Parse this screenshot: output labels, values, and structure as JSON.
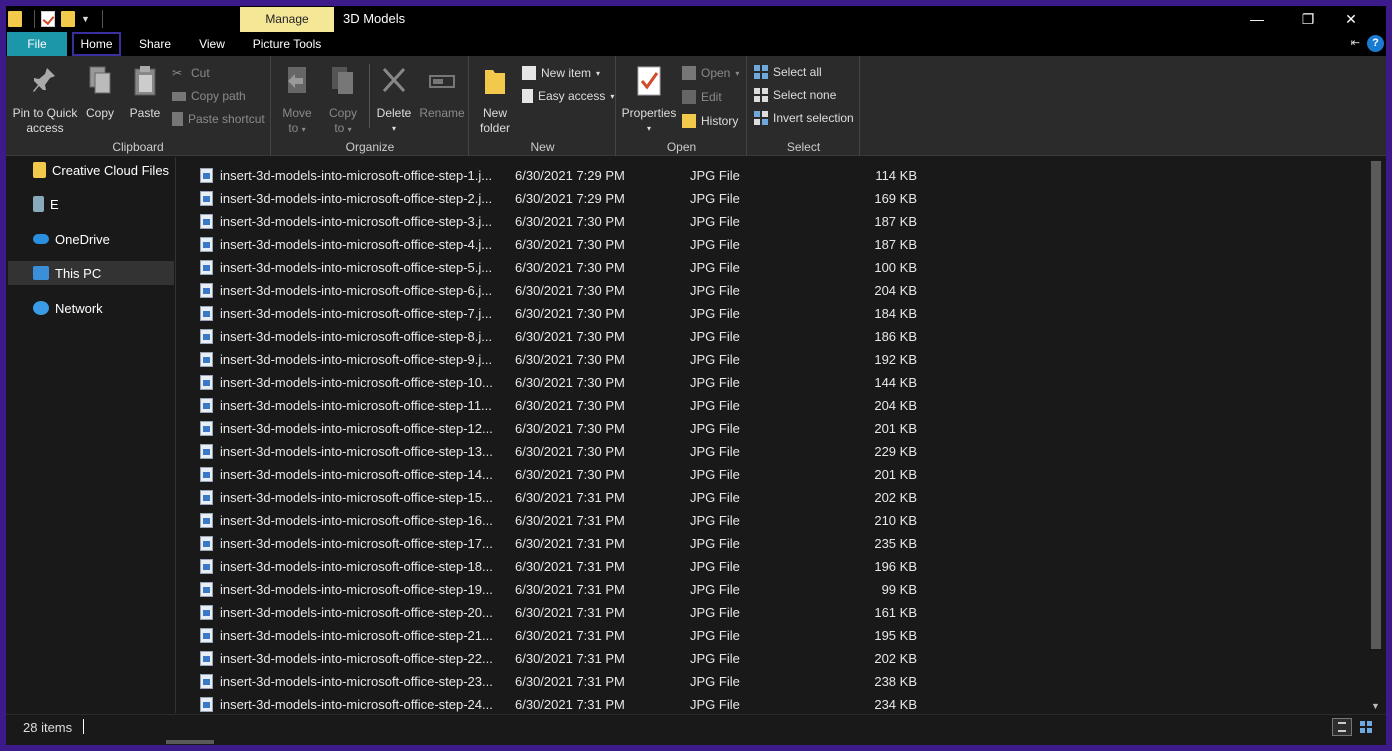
{
  "window": {
    "title": "3D Models",
    "contextual_tab": "Manage",
    "minimize": "—",
    "restore": "❐",
    "close": "✕"
  },
  "tabs": {
    "file": "File",
    "home": "Home",
    "share": "Share",
    "view": "View",
    "picture_tools": "Picture Tools",
    "help": "?"
  },
  "ribbon": {
    "clipboard": {
      "label": "Clipboard",
      "pin_line1": "Pin to Quick",
      "pin_line2": "access",
      "copy": "Copy",
      "paste": "Paste",
      "cut": "Cut",
      "copy_path": "Copy path",
      "paste_shortcut": "Paste shortcut"
    },
    "organize": {
      "label": "Organize",
      "move_line1": "Move",
      "move_line2": "to",
      "copy_line1": "Copy",
      "copy_line2": "to",
      "delete": "Delete",
      "rename": "Rename"
    },
    "new": {
      "label": "New",
      "new_folder_line1": "New",
      "new_folder_line2": "folder",
      "new_item": "New item",
      "easy_access": "Easy access"
    },
    "open": {
      "label": "Open",
      "properties": "Properties",
      "open": "Open",
      "edit": "Edit",
      "history": "History"
    },
    "select": {
      "label": "Select",
      "select_all": "Select all",
      "select_none": "Select none",
      "invert_selection": "Invert selection"
    }
  },
  "nav": {
    "items": [
      {
        "label": "Creative Cloud Files",
        "icon": "creative-cloud-folder-icon"
      },
      {
        "label": "E",
        "icon": "drive-icon"
      },
      {
        "label": "OneDrive",
        "icon": "onedrive-icon"
      },
      {
        "label": "This PC",
        "icon": "this-pc-icon"
      },
      {
        "label": "Network",
        "icon": "network-icon"
      }
    ]
  },
  "files": [
    {
      "name": "insert-3d-models-into-microsoft-office-step-1.j...",
      "date": "6/30/2021 7:29 PM",
      "type": "JPG File",
      "size": "114 KB"
    },
    {
      "name": "insert-3d-models-into-microsoft-office-step-2.j...",
      "date": "6/30/2021 7:29 PM",
      "type": "JPG File",
      "size": "169 KB"
    },
    {
      "name": "insert-3d-models-into-microsoft-office-step-3.j...",
      "date": "6/30/2021 7:30 PM",
      "type": "JPG File",
      "size": "187 KB"
    },
    {
      "name": "insert-3d-models-into-microsoft-office-step-4.j...",
      "date": "6/30/2021 7:30 PM",
      "type": "JPG File",
      "size": "187 KB"
    },
    {
      "name": "insert-3d-models-into-microsoft-office-step-5.j...",
      "date": "6/30/2021 7:30 PM",
      "type": "JPG File",
      "size": "100 KB"
    },
    {
      "name": "insert-3d-models-into-microsoft-office-step-6.j...",
      "date": "6/30/2021 7:30 PM",
      "type": "JPG File",
      "size": "204 KB"
    },
    {
      "name": "insert-3d-models-into-microsoft-office-step-7.j...",
      "date": "6/30/2021 7:30 PM",
      "type": "JPG File",
      "size": "184 KB"
    },
    {
      "name": "insert-3d-models-into-microsoft-office-step-8.j...",
      "date": "6/30/2021 7:30 PM",
      "type": "JPG File",
      "size": "186 KB"
    },
    {
      "name": "insert-3d-models-into-microsoft-office-step-9.j...",
      "date": "6/30/2021 7:30 PM",
      "type": "JPG File",
      "size": "192 KB"
    },
    {
      "name": "insert-3d-models-into-microsoft-office-step-10...",
      "date": "6/30/2021 7:30 PM",
      "type": "JPG File",
      "size": "144 KB"
    },
    {
      "name": "insert-3d-models-into-microsoft-office-step-11...",
      "date": "6/30/2021 7:30 PM",
      "type": "JPG File",
      "size": "204 KB"
    },
    {
      "name": "insert-3d-models-into-microsoft-office-step-12...",
      "date": "6/30/2021 7:30 PM",
      "type": "JPG File",
      "size": "201 KB"
    },
    {
      "name": "insert-3d-models-into-microsoft-office-step-13...",
      "date": "6/30/2021 7:30 PM",
      "type": "JPG File",
      "size": "229 KB"
    },
    {
      "name": "insert-3d-models-into-microsoft-office-step-14...",
      "date": "6/30/2021 7:30 PM",
      "type": "JPG File",
      "size": "201 KB"
    },
    {
      "name": "insert-3d-models-into-microsoft-office-step-15...",
      "date": "6/30/2021 7:31 PM",
      "type": "JPG File",
      "size": "202 KB"
    },
    {
      "name": "insert-3d-models-into-microsoft-office-step-16...",
      "date": "6/30/2021 7:31 PM",
      "type": "JPG File",
      "size": "210 KB"
    },
    {
      "name": "insert-3d-models-into-microsoft-office-step-17...",
      "date": "6/30/2021 7:31 PM",
      "type": "JPG File",
      "size": "235 KB"
    },
    {
      "name": "insert-3d-models-into-microsoft-office-step-18...",
      "date": "6/30/2021 7:31 PM",
      "type": "JPG File",
      "size": "196 KB"
    },
    {
      "name": "insert-3d-models-into-microsoft-office-step-19...",
      "date": "6/30/2021 7:31 PM",
      "type": "JPG File",
      "size": "99 KB"
    },
    {
      "name": "insert-3d-models-into-microsoft-office-step-20...",
      "date": "6/30/2021 7:31 PM",
      "type": "JPG File",
      "size": "161 KB"
    },
    {
      "name": "insert-3d-models-into-microsoft-office-step-21...",
      "date": "6/30/2021 7:31 PM",
      "type": "JPG File",
      "size": "195 KB"
    },
    {
      "name": "insert-3d-models-into-microsoft-office-step-22...",
      "date": "6/30/2021 7:31 PM",
      "type": "JPG File",
      "size": "202 KB"
    },
    {
      "name": "insert-3d-models-into-microsoft-office-step-23...",
      "date": "6/30/2021 7:31 PM",
      "type": "JPG File",
      "size": "238 KB"
    },
    {
      "name": "insert-3d-models-into-microsoft-office-step-24...",
      "date": "6/30/2021 7:31 PM",
      "type": "JPG File",
      "size": "234 KB"
    }
  ],
  "status": {
    "item_count": "28 items"
  },
  "colors": {
    "file_tab": "#1c97a9",
    "manage_tab": "#f4e897",
    "background": "#191919",
    "frame": "#3d1a8a"
  }
}
